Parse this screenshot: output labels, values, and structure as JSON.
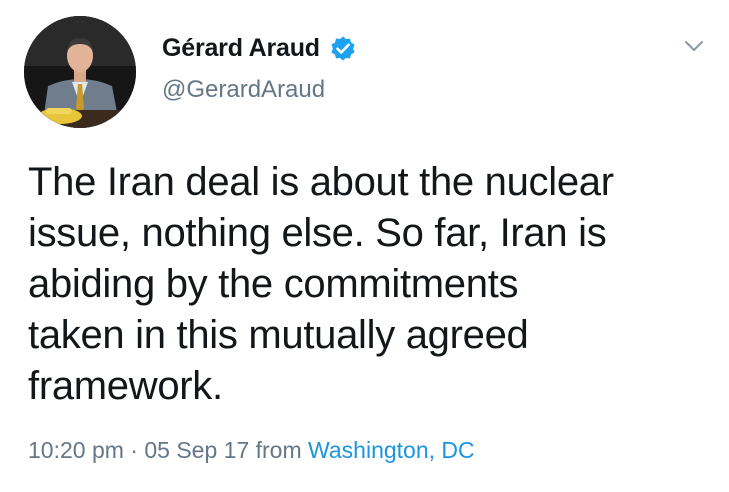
{
  "author": {
    "display_name": "Gérard Araud",
    "handle": "@GerardAraud",
    "verified": true,
    "avatar_icon": "profile-photo"
  },
  "tweet": {
    "text": "The Iran deal is about the nuclear\nissue, nothing else. So far, Iran is\nabiding by the commitments\ntaken in this mutually agreed\nframework."
  },
  "meta": {
    "time": "10:20 pm",
    "separator": " · ",
    "date": "05 Sep 17",
    "from_label": " from ",
    "location": "Washington, DC"
  },
  "menu": {
    "icon": "chevron-down-icon"
  },
  "colors": {
    "text": "#14171a",
    "secondary": "#657786",
    "link": "#1b95e0",
    "verified": "#1da1f2"
  }
}
